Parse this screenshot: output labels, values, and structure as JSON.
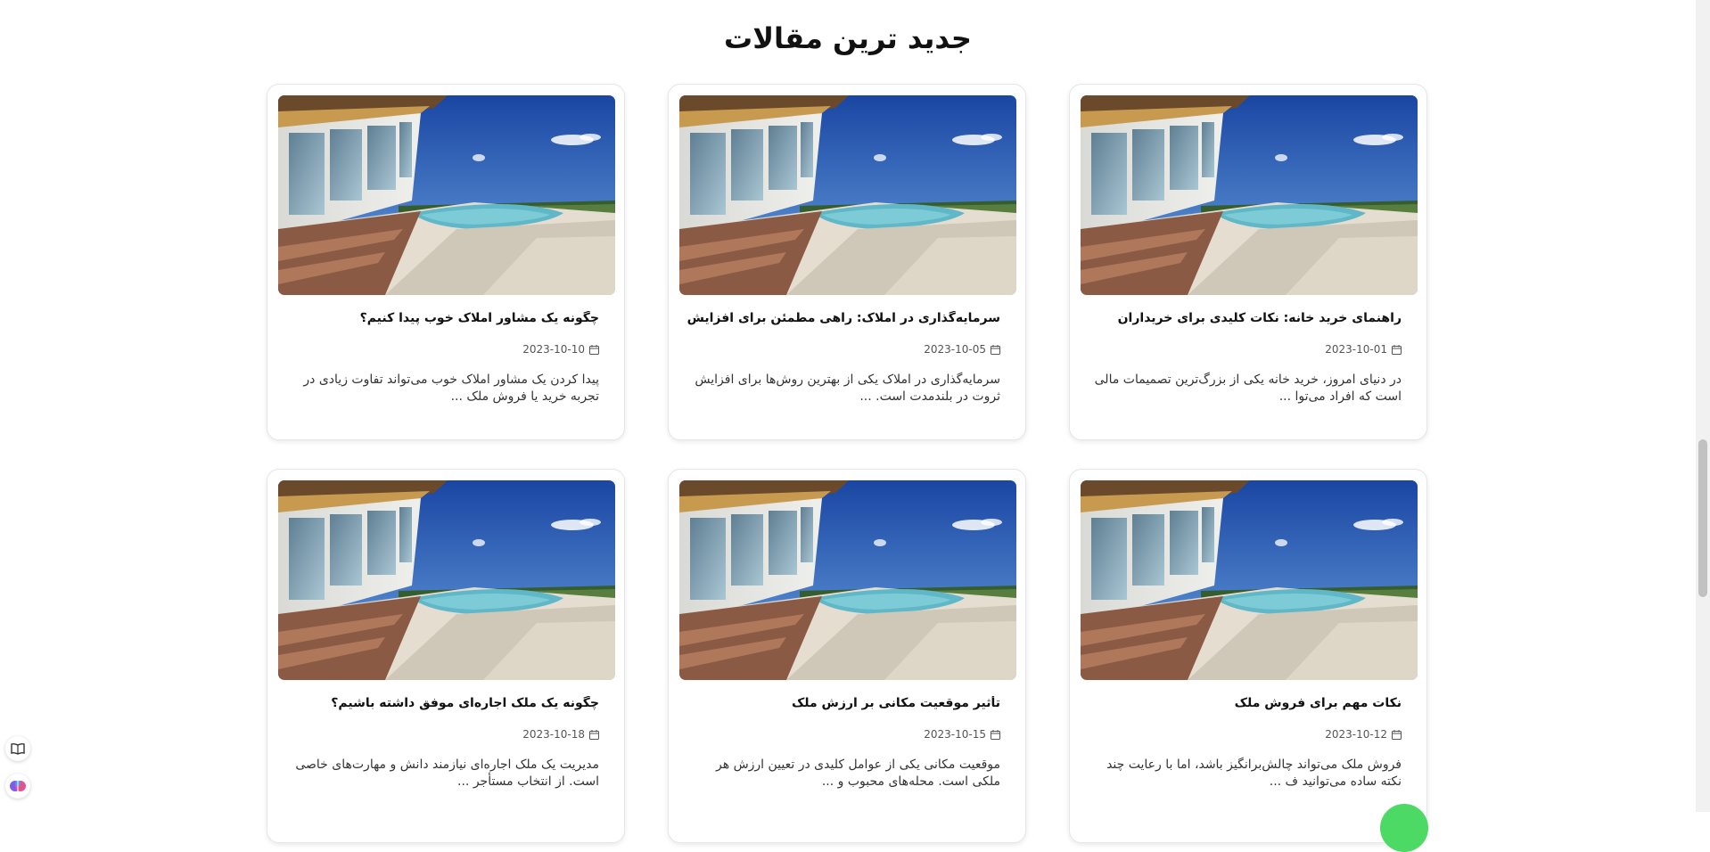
{
  "section": {
    "title": "جدید ترین مقالات"
  },
  "articles": [
    {
      "title": "راهنمای خرید خانه: نکات کلیدی برای خریداران",
      "date": "2023-10-01",
      "excerpt": "در دنیای امروز، خرید خانه یکی از بزرگ‌ترین تصمیمات مالی است که افراد می‌توا ..."
    },
    {
      "title": "سرمایه‌گذاری در املاک: راهی مطمئن برای افزایش ثروت",
      "date": "2023-10-05",
      "excerpt": "سرمایه‌گذاری در املاک یکی از بهترین روش‌ها برای افزایش ثروت در بلندمدت است. ..."
    },
    {
      "title": "چگونه یک مشاور املاک خوب پیدا کنیم؟",
      "date": "2023-10-10",
      "excerpt": "پیدا کردن یک مشاور املاک خوب می‌تواند تفاوت زیادی در تجربه خرید یا فروش ملک ..."
    },
    {
      "title": "نکات مهم برای فروش ملک",
      "date": "2023-10-12",
      "excerpt": "فروش ملک می‌تواند چالش‌برانگیز باشد، اما با رعایت چند نکته ساده می‌توانید ف ..."
    },
    {
      "title": "تأثیر موقعیت مکانی بر ارزش ملک",
      "date": "2023-10-15",
      "excerpt": "موقعیت مکانی یکی از عوامل کلیدی در تعیین ارزش هر ملکی است. محله‌های محبوب و ..."
    },
    {
      "title": "چگونه یک ملک اجاره‌ای موفق داشته باشیم؟",
      "date": "2023-10-18",
      "excerpt": "مدیریت یک ملک اجاره‌ای نیازمند دانش و مهارت‌های خاصی است. از انتخاب مستأجر ..."
    }
  ],
  "icons": {
    "date": "calendar-icon",
    "tool_1": "book-icon",
    "tool_2": "brain-icon"
  },
  "colors": {
    "sky": "#1d4fa8",
    "pool": "#5fb7c7",
    "deck": "#8a5a44",
    "bubble": "#4cd964"
  }
}
